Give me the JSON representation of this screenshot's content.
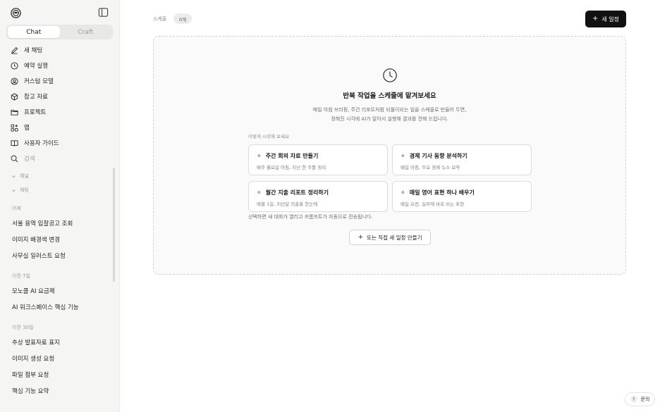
{
  "sidebar": {
    "tabs": [
      {
        "label": "Chat",
        "active": true
      },
      {
        "label": "Craft",
        "active": false
      }
    ],
    "nav": [
      {
        "label": "새 채팅",
        "icon": "edit-icon"
      },
      {
        "label": "예약 실행",
        "icon": "clock-icon"
      },
      {
        "label": "커스텀 모델",
        "icon": "user-circle-icon"
      },
      {
        "label": "참고 자료",
        "icon": "cube-icon"
      },
      {
        "label": "프로젝트",
        "icon": "folder-icon"
      },
      {
        "label": "앱",
        "icon": "apps-icon"
      },
      {
        "label": "사용자 가이드",
        "icon": "book-icon"
      },
      {
        "label": "검색",
        "icon": "search-icon"
      }
    ],
    "sub": [
      {
        "label": "채널"
      },
      {
        "label": "채팅"
      }
    ],
    "history": [
      {
        "group": "어제",
        "items": [
          "서울 용역 입찰공고 조회",
          "이미지 배경색 변경",
          "사무실 일러스트 요청"
        ]
      },
      {
        "group": "이전 7일",
        "items": [
          "모노클 AI 요금제",
          "AI 워크스페이스 핵심 기능"
        ]
      },
      {
        "group": "이전 30일",
        "items": [
          "추상 발표자료 표지",
          "이미지 생성 요청",
          "파일 첨부 요청",
          "핵심 기능 요약"
        ]
      }
    ]
  },
  "header": {
    "label": "스케줄",
    "count": "0개",
    "new_button": "새 일정"
  },
  "empty_state": {
    "title": "반복 작업을 스케줄에 맡겨보세요",
    "desc_line1": "매일 아침 브리핑, 주간 리포트처럼 되풀이되는 일을 스케줄로 만들어 두면,",
    "desc_line2": "정해진 시각에 AI가 알아서 실행해 결과를 전해 드립니다.",
    "suggest_label": "이렇게 시작해 보세요",
    "cards": [
      {
        "title": "주간 회의 자료 만들기",
        "sub": "매주 월요일 아침, 지난 한 주를 정리"
      },
      {
        "title": "경제 기사 동향 분석하기",
        "sub": "매일 아침, 주요 경제 뉴스 요약"
      },
      {
        "title": "월간 지출 리포트 정리하기",
        "sub": "매월 1일, 지난달 지출을 한눈에"
      },
      {
        "title": "매일 영어 표현 하나 배우기",
        "sub": "매일 오전, 실무에 바로 쓰는 표현"
      }
    ],
    "hint": "선택하면 새 대화가 열리고 프롬프트가 자동으로 전송됩니다.",
    "alt_button": "또는 직접 새 일정 만들기"
  },
  "help": {
    "icon_text": "?",
    "label": "문의"
  },
  "colors": {
    "primary_button": "#111111",
    "sidebar_bg": "#f5f5f4"
  }
}
